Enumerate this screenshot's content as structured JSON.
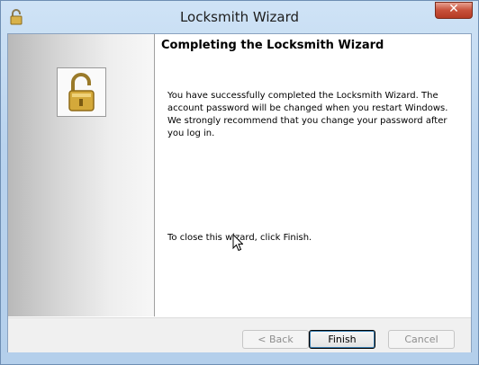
{
  "window": {
    "title": "Locksmith Wizard",
    "close_glyph": "✕"
  },
  "content": {
    "heading": "Completing the Locksmith Wizard",
    "paragraph": "You have successfully completed the Locksmith Wizard. The account password will be changed when you restart Windows. We strongly recommend that you change your password after you log in.",
    "close_hint": "To close this wizard, click Finish."
  },
  "buttons": {
    "back": "< Back",
    "finish": "Finish",
    "cancel": "Cancel"
  },
  "icons": {
    "title": "padlock-icon",
    "side": "open-padlock-icon"
  },
  "colors": {
    "title_bar": "#b9d3ee",
    "close_button": "#c7503a",
    "padlock_gold": "#d4a93a"
  }
}
